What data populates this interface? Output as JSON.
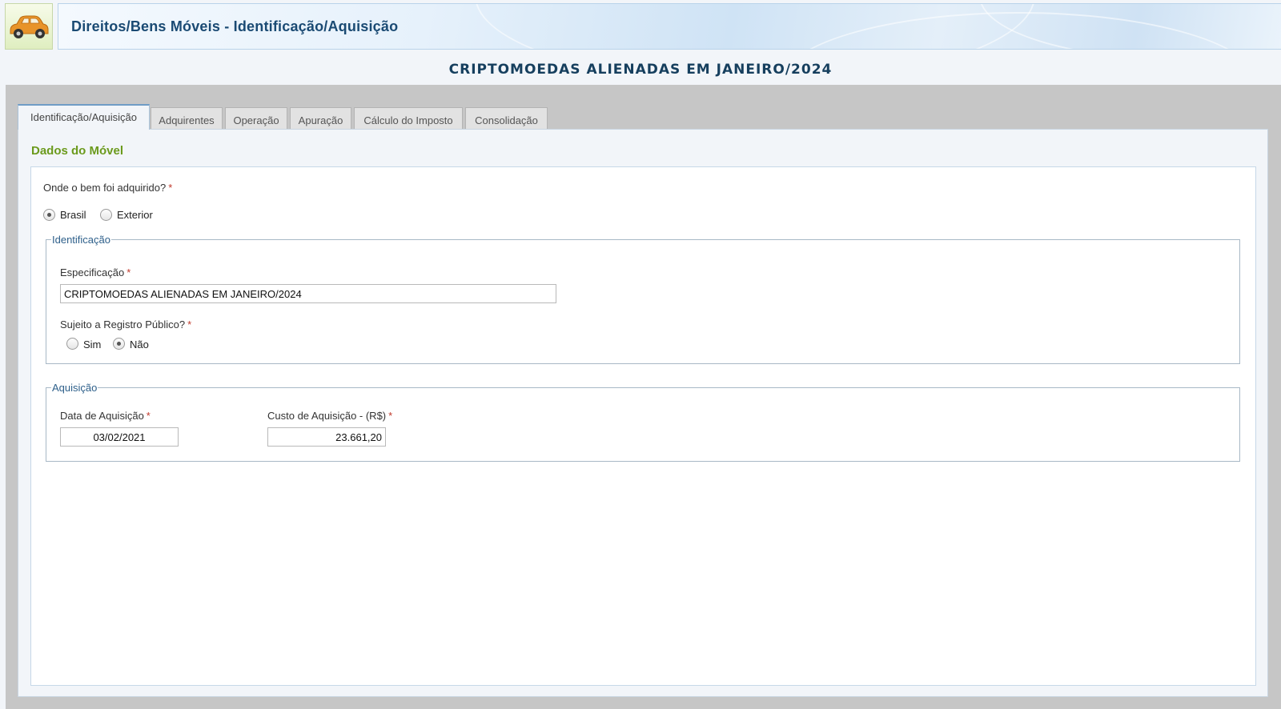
{
  "header": {
    "title": "Direitos/Bens Móveis - Identificação/Aquisição",
    "logo_icon": "car-icon",
    "accent_color": "#1a4a73"
  },
  "page": {
    "heading": "CRIPTOMOEDAS ALIENADAS EM JANEIRO/2024"
  },
  "tabs": [
    {
      "label": "Identificação/Aquisição",
      "active": true
    },
    {
      "label": "Adquirentes",
      "active": false
    },
    {
      "label": "Operação",
      "active": false
    },
    {
      "label": "Apuração",
      "active": false
    },
    {
      "label": "Cálculo do Imposto",
      "active": false
    },
    {
      "label": "Consolidação",
      "active": false
    }
  ],
  "section": {
    "title": "Dados do Móvel",
    "title_color": "#6b9a1c"
  },
  "form": {
    "required_mark": "*",
    "origin": {
      "question": "Onde o bem foi adquirido?",
      "options": [
        {
          "label": "Brasil",
          "checked": true
        },
        {
          "label": "Exterior",
          "checked": false
        }
      ]
    },
    "identificacao": {
      "legend": "Identificação",
      "especificacao_label": "Especificação",
      "especificacao_value": "CRIPTOMOEDAS ALIENADAS EM JANEIRO/2024",
      "registro_question": "Sujeito a Registro Público?",
      "registro_options": [
        {
          "label": "Sim",
          "checked": false
        },
        {
          "label": "Não",
          "checked": true
        }
      ]
    },
    "aquisicao": {
      "legend": "Aquisição",
      "data_label": "Data de Aquisição",
      "data_value": "03/02/2021",
      "custo_label": "Custo de Aquisição - (R$)",
      "custo_value": "23.661,20"
    }
  }
}
